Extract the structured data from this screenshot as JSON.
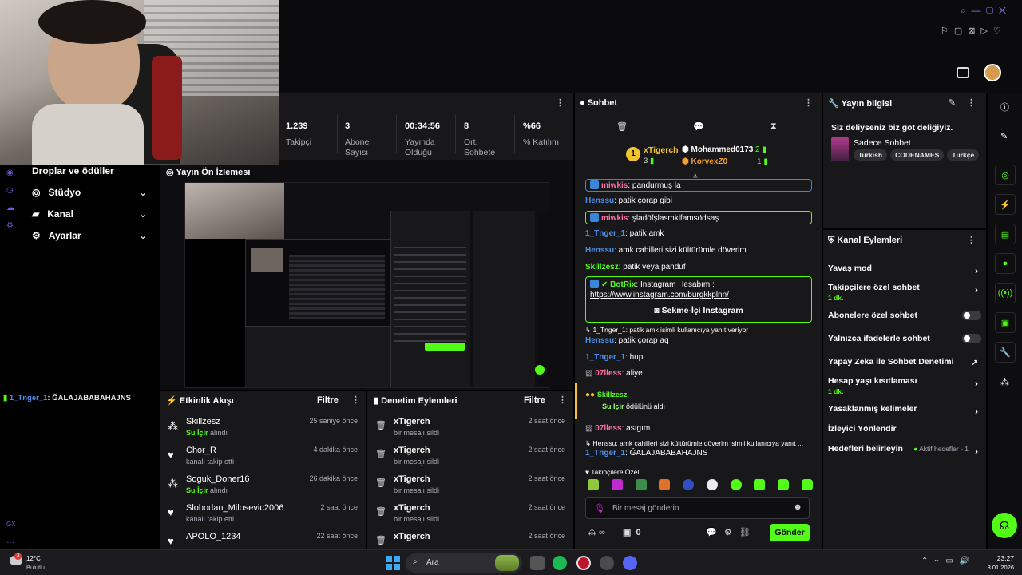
{
  "stats": [
    {
      "value": "1.239",
      "label": "Takipçi"
    },
    {
      "value": "3",
      "label": "Abone Sayısı"
    },
    {
      "value": "00:34:56",
      "label": "Yayında Olduğu"
    },
    {
      "value": "8",
      "label": "Ort. Sohbete"
    },
    {
      "value": "%66",
      "label": "% Katılım"
    }
  ],
  "nav": {
    "drops": "Droplar ve ödüller",
    "studio": "Stüdyo",
    "channel": "Kanal",
    "settings": "Ayarlar",
    "chat_line_user": "1_Tnger_1",
    "chat_line_text": ": ĞALAJABABAHAJNS",
    "gx": "GX"
  },
  "preview": {
    "title": "Yayın Ön İzlemesi"
  },
  "activity": {
    "title": "Etkinlik Akışı",
    "filter": "Filtre",
    "rows": [
      {
        "name": "Skillzesz",
        "highlight": "Su İçir",
        "sub": " alındı",
        "time": "25 saniye önce",
        "icon": "reward"
      },
      {
        "name": "Chor_R",
        "highlight": "",
        "sub": "kanalı takip etti",
        "time": "4 dakika önce",
        "icon": "heart"
      },
      {
        "name": "Soguk_Doner16",
        "highlight": "Su İçir",
        "sub": " alındı",
        "time": "26 dakika önce",
        "icon": "reward"
      },
      {
        "name": "Slobodan_Milosevic2006",
        "highlight": "",
        "sub": "kanalı takip etti",
        "time": "2 saat önce",
        "icon": "heart"
      },
      {
        "name": "APOLO_1234",
        "highlight": "",
        "sub": "",
        "time": "22 saat önce",
        "icon": "heart"
      }
    ]
  },
  "moderation": {
    "title": "Denetim Eylemleri",
    "filter": "Filtre",
    "rows": [
      {
        "name": "xTigerch",
        "sub": "bir mesajı sildi",
        "time": "2 saat önce"
      },
      {
        "name": "xTigerch",
        "sub": "bir mesajı sildi",
        "time": "2 saat önce"
      },
      {
        "name": "xTigerch",
        "sub": "bir mesajı sildi",
        "time": "2 saat önce"
      },
      {
        "name": "xTigerch",
        "sub": "bir mesajı sildi",
        "time": "2 saat önce"
      },
      {
        "name": "xTigerch",
        "sub": "",
        "time": "2 saat önce"
      }
    ]
  },
  "chat": {
    "title": "Sohbet",
    "leader1": "xTigerch",
    "leader1_count": "3",
    "leader2": "Mohammed0173",
    "leader2_count": "2",
    "leader3": "KorvexZ0",
    "leader3_count": "1",
    "messages": [
      {
        "user": "miwkis",
        "text": ": pandurmuş la"
      },
      {
        "user": "Henssu",
        "text": ": patik çorap gibi"
      },
      {
        "user": "miwkis",
        "text": ": şladöfşlasmklfamsödsaş"
      },
      {
        "user": "1_Tnger_1",
        "text": ": patik amk"
      },
      {
        "user": "Henssu",
        "text": ": amk cahilleri sizi kültürümle döverim"
      },
      {
        "user": "Skillzesz",
        "text": ": patik veya panduf"
      }
    ],
    "botrix_user": "BotRix",
    "botrix_text": ": İnstagram Hesabım :",
    "botrix_link": "https://www.instagram.com/burgkkplnn/",
    "botrix_button": "Sekme-İçi Instagram",
    "reply1": "1_Tnger_1: patik amk isimli kullanıcıya yanıt veriyor",
    "msg_henssu2_user": "Henssu",
    "msg_henssu2_text": ": patik çorap aq",
    "msg_hup_user": "1_Tnger_1",
    "msg_hup_text": ": hup",
    "msg_aliye_user": "07lless",
    "msg_aliye_text": ": aliye",
    "reward_user": "Skillzesz",
    "reward_item": "Su İçir",
    "reward_text": " ödülünü aldı",
    "msg_asigim_user": "07lless",
    "msg_asigim_text": ": asıgım",
    "reply2": "Henssu: amk cahilleri sizi kültürümle döverim isimli kullanıcıya yanıt ...",
    "last_user": "1_Tnger_1",
    "last_text": ": ĞALAJABABAHAJNS",
    "followers_only": "Takipçilere Özel",
    "placeholder": "Bir mesaj gönderin",
    "count": "0",
    "send": "Gönder"
  },
  "stream_info": {
    "title": "Yayın bilgisi",
    "stream_title": "Siz deliyseniz biz göt deliğiyiz.",
    "category": "Sadece Sohbet",
    "tags": [
      "Turkish",
      "CODENAMES",
      "Türkçe"
    ]
  },
  "channel_actions": {
    "title": "Kanal Eylemleri",
    "slow_mode": "Yavaş mod",
    "followers_chat": "Takipçilere özel sohbet",
    "followers_chat_sub": "1 dk.",
    "subs_chat": "Abonelere özel sohbet",
    "emote_chat": "Yalnızca ifadelerle sohbet",
    "ai_moderation": "Yapay Zeka ile Sohbet Denetimi",
    "age_restriction": "Hesap yaşı kısıtlaması",
    "age_restriction_sub": "1 dk.",
    "banned_words": "Yasaklanmış kelimeler",
    "viewer_redirect": "İzleyici Yönlendir",
    "set_goals": "Hedefleri belirleyin",
    "active_goals": "Aktif hedefler - 1"
  },
  "taskbar": {
    "weather_temp": "12°C",
    "weather_text": "Bulutlu",
    "search": "Ara",
    "time": "23:27",
    "date": "3.01.2026",
    "weather_badge": "3"
  },
  "colors": {
    "accent": "#53fc18",
    "panel": "#18181b",
    "bg": "#000000"
  }
}
